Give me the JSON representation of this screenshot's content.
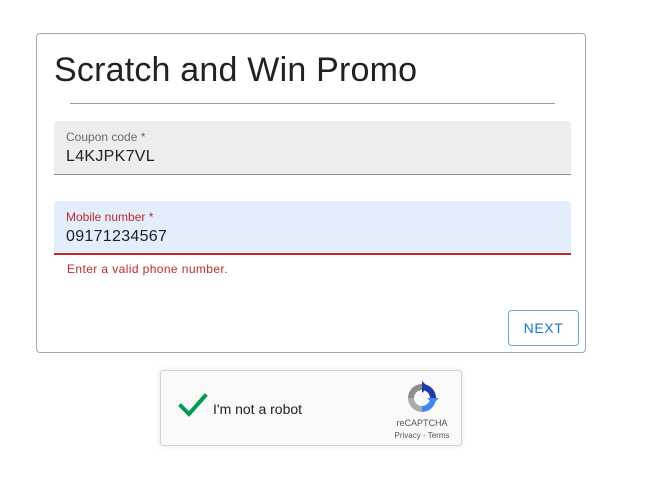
{
  "form": {
    "title": "Scratch and Win Promo",
    "coupon": {
      "label": "Coupon code *",
      "value": "L4KJPK7VL"
    },
    "mobile": {
      "label": "Mobile number *",
      "value": "09171234567",
      "error": "Enter a valid phone number."
    },
    "next_label": "NEXT"
  },
  "recaptcha": {
    "checkbox_label": "I'm not a robot",
    "brand": "reCAPTCHA",
    "privacy_label": "Privacy",
    "separator": " - ",
    "terms_label": "Terms",
    "checked": true,
    "check_color": "#009e55"
  },
  "colors": {
    "error": "#c62828",
    "accent": "#1976d2",
    "mobile_field_bg": "#e2eefb",
    "coupon_field_bg": "#ededed"
  }
}
